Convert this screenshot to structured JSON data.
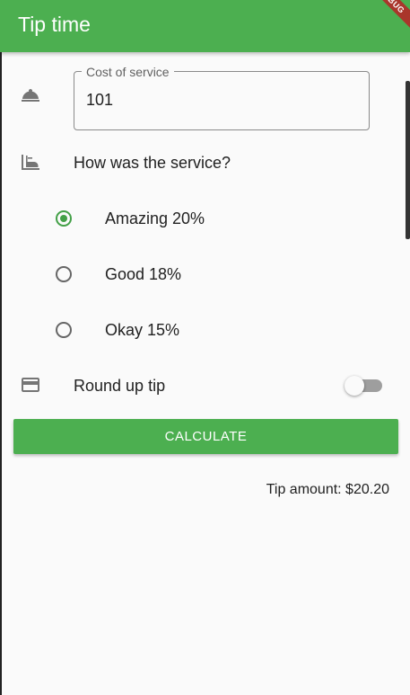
{
  "app_bar": {
    "title": "Tip time",
    "debug_banner": "DEBUG"
  },
  "colors": {
    "primary": "#4caf50",
    "radio_selected": "#43a047",
    "banner": "#a9362b"
  },
  "cost_field": {
    "label": "Cost of service",
    "value": "101",
    "icon": "room-service-icon"
  },
  "service_question": {
    "label": "How was the service?",
    "icon": "dinner-dining-icon"
  },
  "tip_options": [
    {
      "label": "Amazing 20%",
      "selected": true
    },
    {
      "label": "Good 18%",
      "selected": false
    },
    {
      "label": "Okay 15%",
      "selected": false
    }
  ],
  "round_up": {
    "label": "Round up tip",
    "enabled": false,
    "icon": "credit-card-icon"
  },
  "calculate_button": {
    "label": "CALCULATE"
  },
  "result": {
    "text": "Tip amount: $20.20"
  }
}
